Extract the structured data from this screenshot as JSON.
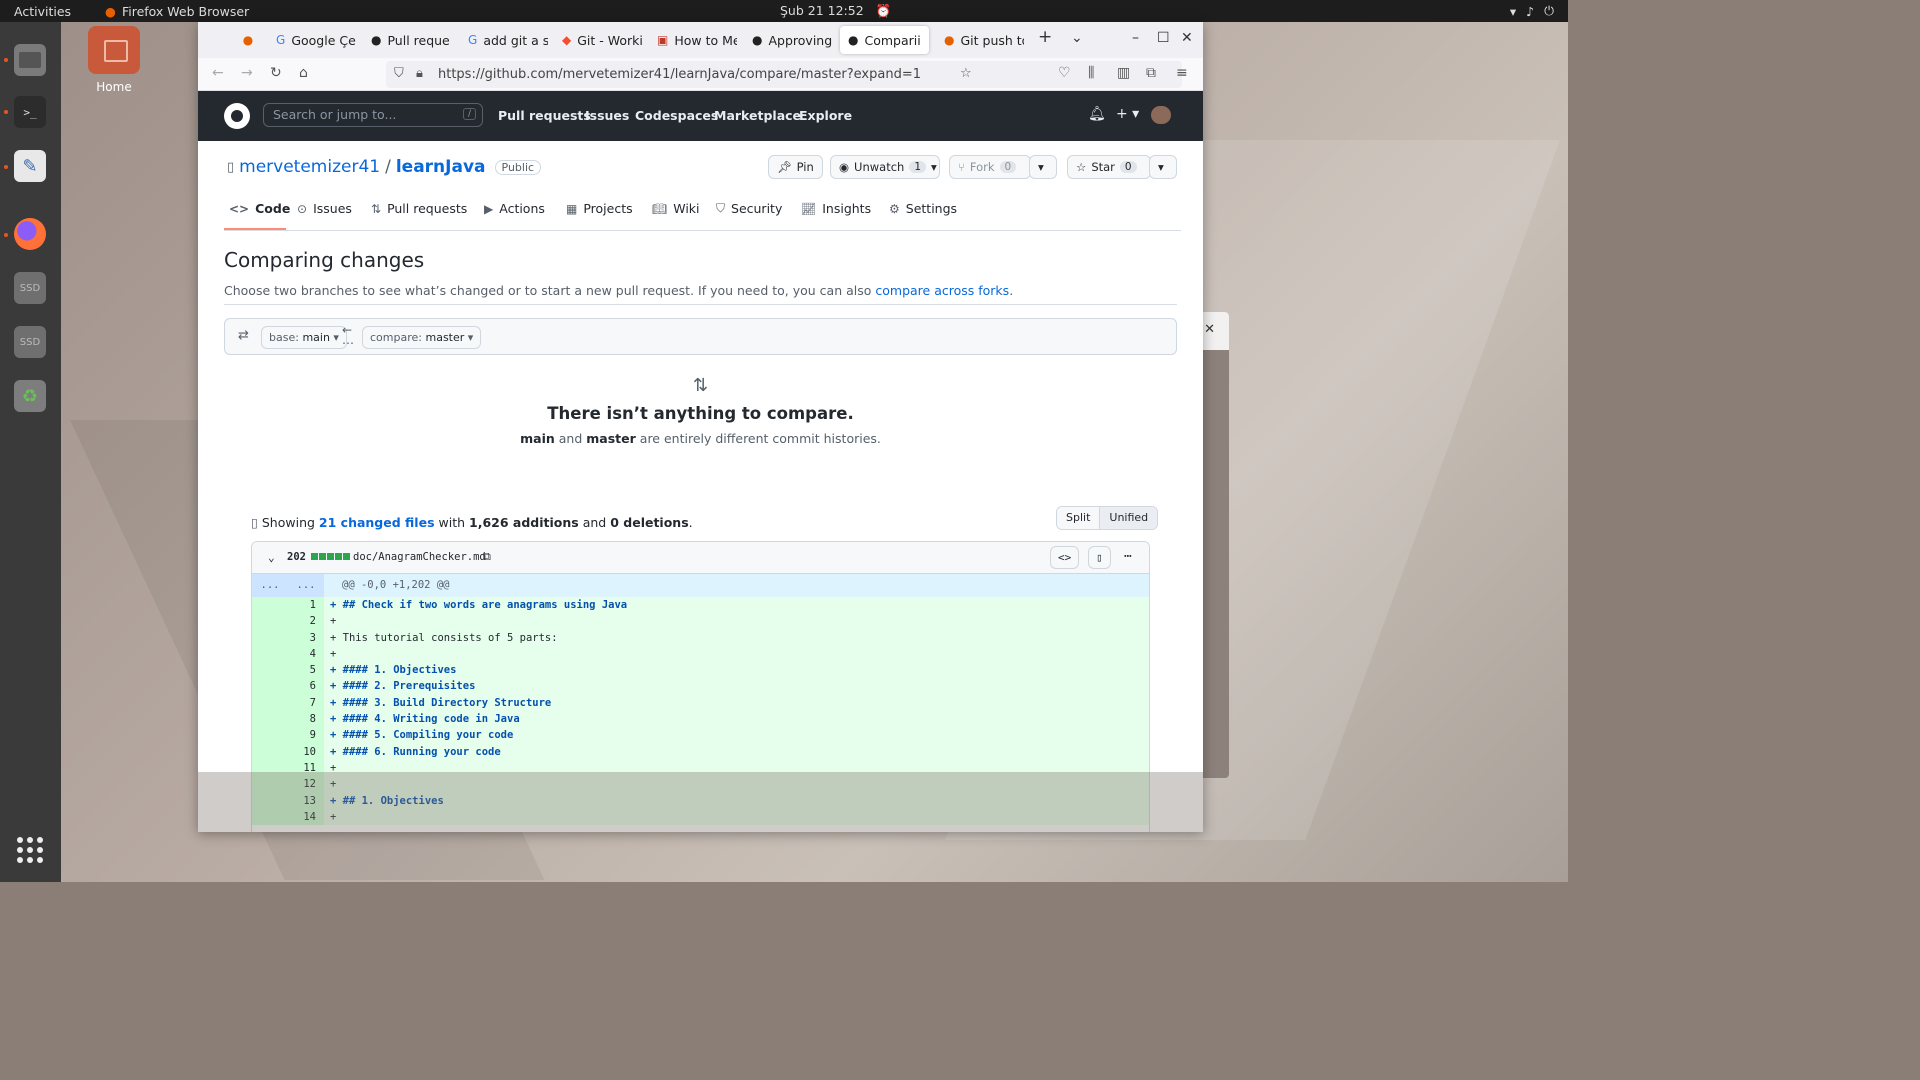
{
  "desktop": {
    "topbar": {
      "activities": "Activities",
      "app_name": "Firefox Web Browser",
      "clock": "Şub 21  12:52"
    },
    "home_icon_label": "Home",
    "dock": {
      "items": [
        {
          "name": "files",
          "label": ""
        },
        {
          "name": "terminal",
          "label": ">_"
        },
        {
          "name": "text-editor",
          "label": ""
        },
        {
          "name": "firefox",
          "label": ""
        },
        {
          "name": "ssd-1",
          "label": "SSD"
        },
        {
          "name": "ssd-2",
          "label": "SSD"
        },
        {
          "name": "trash",
          "label": ""
        }
      ]
    }
  },
  "browser": {
    "tabs": [
      {
        "title": "",
        "icon": "firefox-icon"
      },
      {
        "title": "Google Çev",
        "icon": "google-translate-icon"
      },
      {
        "title": "Pull reque",
        "icon": "github-icon"
      },
      {
        "title": "add git a si",
        "icon": "google-icon"
      },
      {
        "title": "Git - Worki",
        "icon": "git-icon"
      },
      {
        "title": "How to Me",
        "icon": "stackoverflow-icon"
      },
      {
        "title": "Approving",
        "icon": "github-icon"
      },
      {
        "title": "Comparii",
        "icon": "github-icon"
      },
      {
        "title": "Git push to",
        "icon": "firefox-icon"
      }
    ],
    "url": "https://github.com/mervetemizer41/learnJava/compare/master?expand=1"
  },
  "github": {
    "search_placeholder": "Search or jump to...",
    "search_shortcut": "/",
    "nav": [
      "Pull requests",
      "Issues",
      "Codespaces",
      "Marketplace",
      "Explore"
    ],
    "repo": {
      "owner": "mervetemizer41",
      "separator": "/",
      "name": "learnJava",
      "visibility": "Public",
      "pin_label": "Pin",
      "watch_label": "Unwatch",
      "watch_count": "1",
      "fork_label": "Fork",
      "fork_count": "0",
      "star_label": "Star",
      "star_count": "0"
    },
    "repo_tabs": [
      "Code",
      "Issues",
      "Pull requests",
      "Actions",
      "Projects",
      "Wiki",
      "Security",
      "Insights",
      "Settings"
    ],
    "compare": {
      "title": "Comparing changes",
      "description": "Choose two branches to see what’s changed or to start a new pull request. If you need to, you can also",
      "forks_link": "compare across forks",
      "period": ".",
      "base_label": "base:",
      "base_value": "main",
      "compare_label": "compare:",
      "compare_value": "master",
      "empty_title": "There isn’t anything to compare.",
      "empty_branch_a": "main",
      "empty_and": "and",
      "empty_branch_b": "master",
      "empty_rest": "are entirely different commit histories."
    },
    "toc": {
      "showing": "Showing",
      "changed_files": "21 changed files",
      "with": "with",
      "additions": "1,626 additions",
      "and": "and",
      "deletions": "0 deletions",
      "period": "."
    },
    "view_toggle": {
      "split": "Split",
      "unified": "Unified"
    },
    "file": {
      "count": "202",
      "name": "doc/AnagramChecker.md",
      "hunk_left": "...",
      "hunk_right": "...",
      "hunk_header": "@@ -0,0 +1,202 @@",
      "lines": [
        {
          "n": "1",
          "text": "+ ## Check if two words are anagrams using Java",
          "heading": true
        },
        {
          "n": "2",
          "text": "+",
          "heading": false
        },
        {
          "n": "3",
          "text": "+ This tutorial consists of 5 parts:",
          "heading": false
        },
        {
          "n": "4",
          "text": "+",
          "heading": false
        },
        {
          "n": "5",
          "text": "+ #### 1. Objectives",
          "heading": true
        },
        {
          "n": "6",
          "text": "+ #### 2. Prerequisites",
          "heading": true
        },
        {
          "n": "7",
          "text": "+ #### 3. Build Directory Structure",
          "heading": true
        },
        {
          "n": "8",
          "text": "+ #### 4. Writing code in Java",
          "heading": true
        },
        {
          "n": "9",
          "text": "+ #### 5. Compiling your code",
          "heading": true
        },
        {
          "n": "10",
          "text": "+ #### 6. Running your code",
          "heading": true
        },
        {
          "n": "11",
          "text": "+",
          "heading": false
        },
        {
          "n": "12",
          "text": "+",
          "heading": false
        },
        {
          "n": "13",
          "text": "+ ## 1. Objectives",
          "heading": true
        },
        {
          "n": "14",
          "text": "+",
          "heading": false
        }
      ]
    }
  },
  "colors": {
    "accent": "#0969da",
    "added_bg": "#e6ffec",
    "added_num_bg": "#ccffd8",
    "header_bg": "#24292f",
    "ubuntu_orange": "#e95420"
  }
}
